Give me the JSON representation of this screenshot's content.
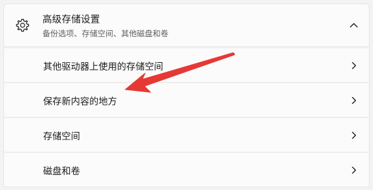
{
  "section": {
    "icon": "gear-icon",
    "title": "高级存储设置",
    "subtitle": "备份选项、存储空间、其他磁盘和卷",
    "expand_icon": "chevron-up-icon"
  },
  "items": [
    {
      "label": "其他驱动器上使用的存储空间",
      "icon": "chevron-right-icon"
    },
    {
      "label": "保存新内容的地方",
      "icon": "chevron-right-icon"
    },
    {
      "label": "存储空间",
      "icon": "chevron-right-icon"
    },
    {
      "label": "磁盘和卷",
      "icon": "chevron-right-icon"
    }
  ],
  "annotation": {
    "type": "red-arrow",
    "color": "#e53935"
  }
}
